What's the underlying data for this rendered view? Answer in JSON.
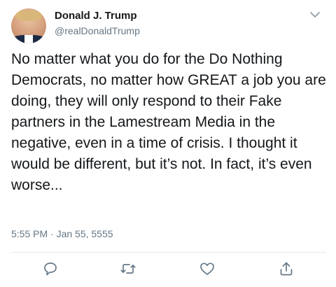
{
  "tweet": {
    "author_name": "Donald J. Trump",
    "handle": "@realDonaldTrump",
    "text": "No matter what you do for the Do Nothing Democrats, no matter how GREAT a job you are doing, they will only respond to their Fake partners in the Lamestream Media in the negative, even in a time of crisis. I thought it would be different, but it’s not. In fact, it’s even worse...",
    "timestamp": "5:55 PM · Jan 55, 5555"
  },
  "icons": {
    "menu": "chevron-down-icon",
    "reply": "reply-icon",
    "retweet": "retweet-icon",
    "like": "heart-icon",
    "share": "share-icon"
  },
  "colors": {
    "text": "#14171a",
    "secondary": "#657786",
    "divider": "#e1e8ed"
  }
}
